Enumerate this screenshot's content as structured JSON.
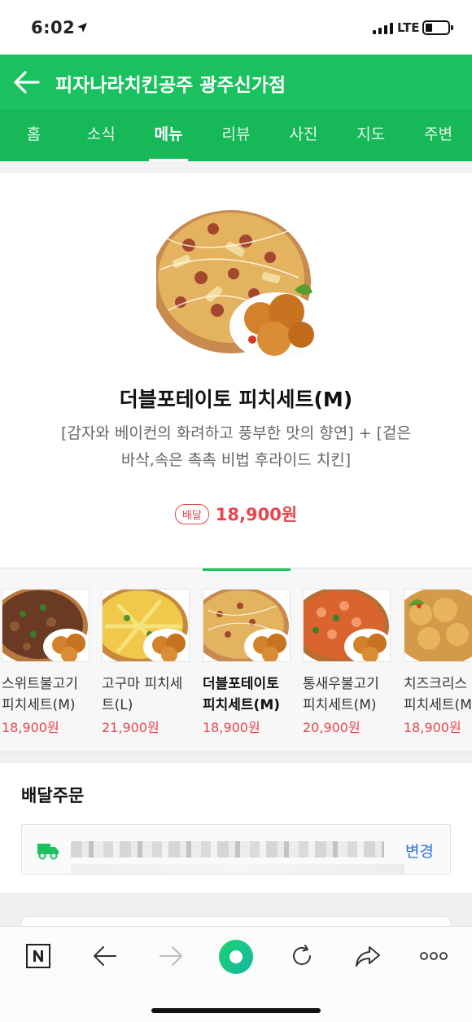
{
  "status": {
    "time": "6:02",
    "network": "LTE"
  },
  "header": {
    "title": "피자나라치킨공주 광주신가점"
  },
  "tabs": [
    "홈",
    "소식",
    "메뉴",
    "리뷰",
    "사진",
    "지도",
    "주변"
  ],
  "active_tab": 2,
  "product": {
    "name": "더블포테이토 피치세트(M)",
    "description_line1": "[감자와 베이컨의 화려하고 풍부한 맛의 향연] + [겉은",
    "description_line2": "바삭,속은 촉촉 비법 후라이드 치킨]",
    "badge": "배달",
    "price": "18,900원"
  },
  "carousel": [
    {
      "line1": "스위트불고기",
      "line2": "피치세트(M)",
      "price": "18,900원",
      "current": false
    },
    {
      "line1": "고구마 피치세",
      "line2": "트(L)",
      "price": "21,900원",
      "current": false
    },
    {
      "line1": "더블포테이토",
      "line2": "피치세트(M)",
      "price": "18,900원",
      "current": true
    },
    {
      "line1": "통새우불고기",
      "line2": "피치세트(M)",
      "price": "20,900원",
      "current": false
    },
    {
      "line1": "치즈크리스",
      "line2": "피치세트(M",
      "price": "18,900원",
      "current": false
    }
  ],
  "order": {
    "title": "배달주문",
    "change_label": "변경"
  },
  "colors": {
    "brand_green": "#19c25e",
    "price_red": "#e5484d",
    "link_blue": "#2a6fd6"
  },
  "icons": [
    "navigation-arrow-icon",
    "signal-icon",
    "battery-icon",
    "back-arrow-icon",
    "truck-icon",
    "naver-n-icon",
    "browser-back-icon",
    "browser-forward-icon",
    "green-dot-icon",
    "reload-icon",
    "share-icon",
    "more-icon"
  ]
}
